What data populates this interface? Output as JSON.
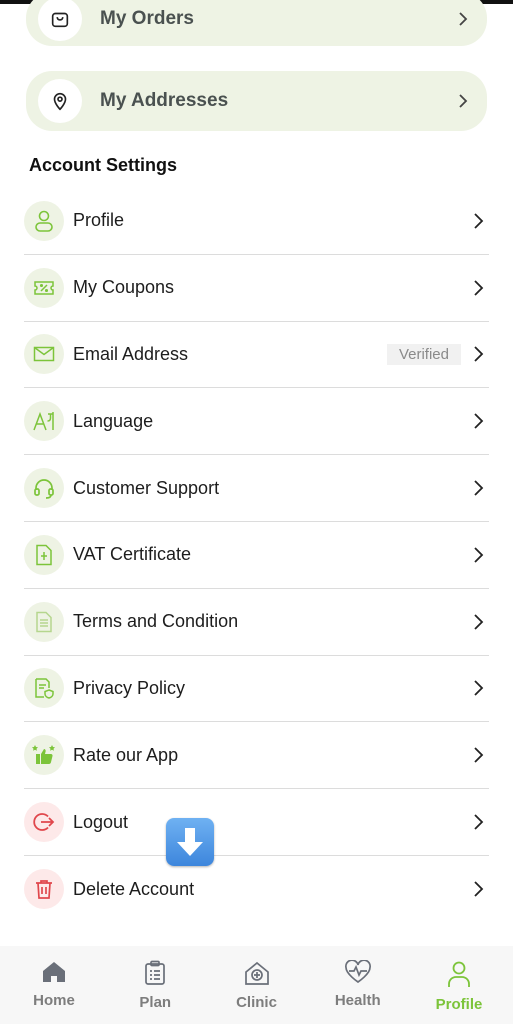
{
  "top_links": [
    {
      "label": "My Orders",
      "icon": "shopping-bag-icon"
    },
    {
      "label": "My Addresses",
      "icon": "location-pin-icon"
    }
  ],
  "account_settings": {
    "title": "Account Settings",
    "items": [
      {
        "label": "Profile",
        "icon": "user-icon"
      },
      {
        "label": "My Coupons",
        "icon": "coupon-icon"
      },
      {
        "label": "Email Address",
        "icon": "mail-icon",
        "badge": "Verified"
      },
      {
        "label": "Language",
        "icon": "language-icon"
      },
      {
        "label": "Customer Support",
        "icon": "headset-icon"
      },
      {
        "label": "VAT Certificate",
        "icon": "certificate-icon"
      },
      {
        "label": "Terms and Condition",
        "icon": "document-icon"
      },
      {
        "label": "Privacy Policy",
        "icon": "privacy-icon"
      },
      {
        "label": "Rate our App",
        "icon": "thumbs-up-icon"
      },
      {
        "label": "Logout",
        "icon": "logout-icon"
      },
      {
        "label": "Delete Account",
        "icon": "trash-icon"
      }
    ]
  },
  "tabs": [
    {
      "label": "Home",
      "icon": "home-icon",
      "active": false
    },
    {
      "label": "Plan",
      "icon": "clipboard-icon",
      "active": false
    },
    {
      "label": "Clinic",
      "icon": "clinic-icon",
      "active": false
    },
    {
      "label": "Health",
      "icon": "heart-pulse-icon",
      "active": false
    },
    {
      "label": "Profile",
      "icon": "profile-icon",
      "active": true
    }
  ],
  "colors": {
    "accent_green": "#7cc43a",
    "pill_bg": "#eef3e4",
    "danger_red": "#e0474c"
  }
}
